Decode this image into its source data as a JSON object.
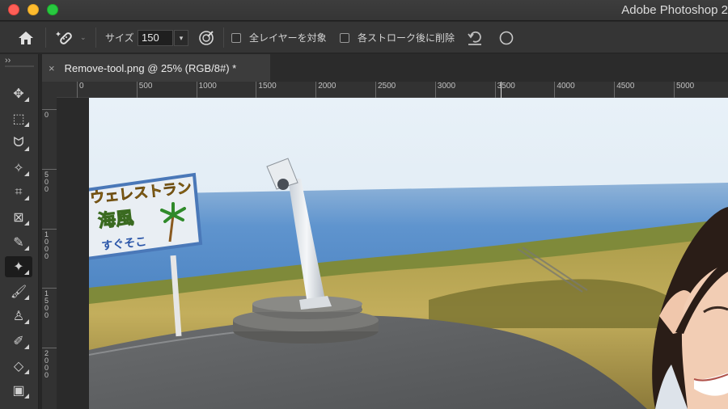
{
  "window": {
    "app_title": "Adobe Photoshop 2"
  },
  "options_bar": {
    "size_label": "サイズ",
    "size_value": "150",
    "all_layers_label": "全レイヤーを対象",
    "remove_after_stroke_label": "各ストローク後に削除"
  },
  "toolbar": {
    "collapse_glyph": "››",
    "tools": [
      {
        "name": "move-tool-icon",
        "glyph": "✥"
      },
      {
        "name": "marquee-tool-icon",
        "glyph": "⬚"
      },
      {
        "name": "lasso-tool-icon",
        "glyph": "ᗢ"
      },
      {
        "name": "magic-wand-tool-icon",
        "glyph": "✧"
      },
      {
        "name": "crop-tool-icon",
        "glyph": "⌗"
      },
      {
        "name": "frame-tool-icon",
        "glyph": "⊠"
      },
      {
        "name": "eyedropper-tool-icon",
        "glyph": "✎"
      },
      {
        "name": "remove-tool-icon",
        "glyph": "✦",
        "active": true
      },
      {
        "name": "brush-tool-icon",
        "glyph": "🖌"
      },
      {
        "name": "stamp-tool-icon",
        "glyph": "♙"
      },
      {
        "name": "history-brush-tool-icon",
        "glyph": "✐"
      },
      {
        "name": "eraser-tool-icon",
        "glyph": "◇"
      },
      {
        "name": "gradient-tool-icon",
        "glyph": "▣"
      }
    ]
  },
  "document_tab": {
    "title": "Remove-tool.png @ 25% (RGB/8#) *",
    "close_glyph": "×"
  },
  "rulers": {
    "horizontal": [
      "0",
      "500",
      "1000",
      "1500",
      "2000",
      "2500",
      "3000",
      "3500",
      "4000",
      "4500",
      "5000"
    ],
    "vertical": [
      "0",
      "500",
      "1000",
      "1500",
      "2000"
    ]
  },
  "photo": {
    "sign_line1": "ウェレストラン",
    "sign_line2": "海風",
    "sign_line3": "すぐそこ"
  },
  "colors": {
    "chrome_dark": "#353535",
    "sky_top": "#e3eef7",
    "sea": "#5a8fcb"
  }
}
